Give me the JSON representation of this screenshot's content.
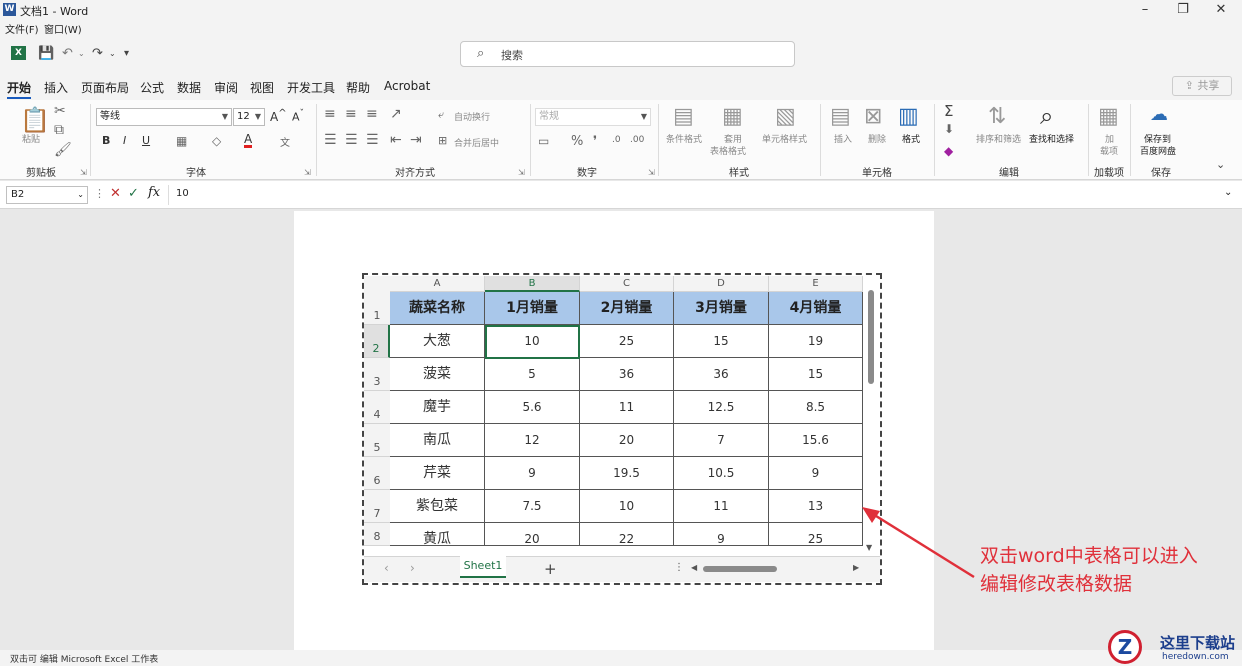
{
  "window": {
    "title": "文档1 - Word",
    "menus": [
      "文件(F)",
      "窗口(W)"
    ]
  },
  "search": {
    "placeholder": "搜索"
  },
  "tabs": [
    "开始",
    "插入",
    "页面布局",
    "公式",
    "数据",
    "审阅",
    "视图",
    "开发工具",
    "帮助",
    "Acrobat"
  ],
  "share_label": "共享",
  "ribbon": {
    "paste": "粘贴",
    "font_name": "等线",
    "font_size": "12",
    "wrap": "自动换行",
    "merge": "合并后居中",
    "num_format": "常规",
    "cond_format": "条件格式",
    "table_format_1": "套用",
    "table_format_2": "表格格式",
    "cell_style": "单元格样式",
    "insert": "插入",
    "delete": "删除",
    "format": "格式",
    "sort_filter": "排序和筛选",
    "find_select": "查找和选择",
    "addin_1": "加",
    "addin_2": "载项",
    "save_baidu_1": "保存到",
    "save_baidu_2": "百度网盘",
    "groups": [
      "剪贴板",
      "字体",
      "对齐方式",
      "数字",
      "样式",
      "单元格",
      "编辑",
      "加载项",
      "保存"
    ]
  },
  "formula_bar": {
    "cell_ref": "B2",
    "value": "10"
  },
  "sheet": {
    "columns": [
      "A",
      "B",
      "C",
      "D",
      "E"
    ],
    "rows": [
      "1",
      "2",
      "3",
      "4",
      "5",
      "6",
      "7",
      "8"
    ],
    "header": [
      "蔬菜名称",
      "1月销量",
      "2月销量",
      "3月销量",
      "4月销量"
    ],
    "data": [
      [
        "大葱",
        "10",
        "25",
        "15",
        "19"
      ],
      [
        "菠菜",
        "5",
        "36",
        "36",
        "15"
      ],
      [
        "魔芋",
        "5.6",
        "11",
        "12.5",
        "8.5"
      ],
      [
        "南瓜",
        "12",
        "20",
        "7",
        "15.6"
      ],
      [
        "芹菜",
        "9",
        "19.5",
        "10.5",
        "9"
      ],
      [
        "紫包菜",
        "7.5",
        "10",
        "11",
        "13"
      ],
      [
        "黄瓜",
        "20",
        "22",
        "9",
        "25"
      ]
    ],
    "tab_name": "Sheet1"
  },
  "annotation": {
    "line1": "双击word中表格可以进入",
    "line2": "编辑修改表格数据"
  },
  "status": "双击可 编辑 Microsoft Excel 工作表",
  "watermark": {
    "title": "这里下载站",
    "url": "heredown.com"
  },
  "colors": {
    "accent": "#217346",
    "header_fill": "#a9c7ea",
    "annotation": "#e0303a"
  }
}
